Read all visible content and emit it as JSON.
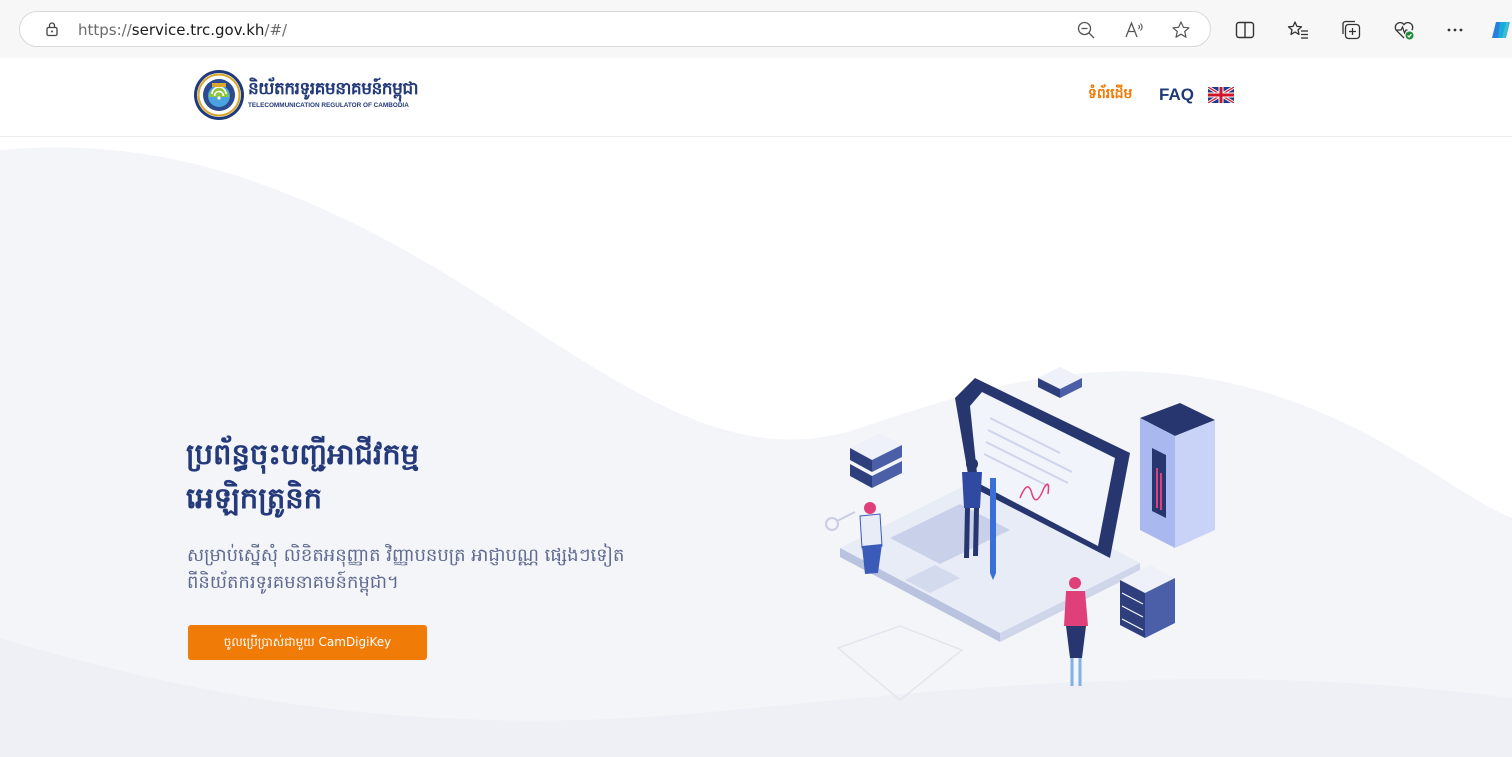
{
  "browser": {
    "url_scheme": "https://",
    "url_host": "service.trc.gov.kh",
    "url_path": "/#/",
    "icons": [
      "lock-icon",
      "zoom-out-icon",
      "read-aloud-icon",
      "favorite-star-icon",
      "split-screen-icon",
      "favorites-icon",
      "collections-icon",
      "browser-health-icon",
      "more-options-icon",
      "copilot-icon"
    ]
  },
  "header": {
    "brand_km": "និយ័តករទូរគមនាគមន៍កម្ពុជា",
    "brand_en": "TELECOMMUNICATION REGULATOR OF CAMBODIA",
    "nav_home": "ទំព័រដើម",
    "nav_faq": "FAQ",
    "flag_icon": "uk-flag-icon"
  },
  "hero": {
    "title_line1": "ប្រព័ន្ធចុះបញ្ជីអាជីវកម្ម",
    "title_line2": "អេឡិកត្រូនិក",
    "subtitle_line1": "សម្រាប់ស្នើសុំ លិខិតអនុញ្ញាត វិញ្ញាបនបត្រ អាជ្ញាបណ្ណ ផ្សេងៗទៀត",
    "subtitle_line2": "ពីនិយ័តករទូរគមនាគមន៍កម្ពុជា។",
    "cta_label": "ចូលប្រើប្រាស់ជាមួយ CamDigiKey"
  },
  "colors": {
    "accent": "#f07b06",
    "brand_blue": "#223a7a"
  }
}
